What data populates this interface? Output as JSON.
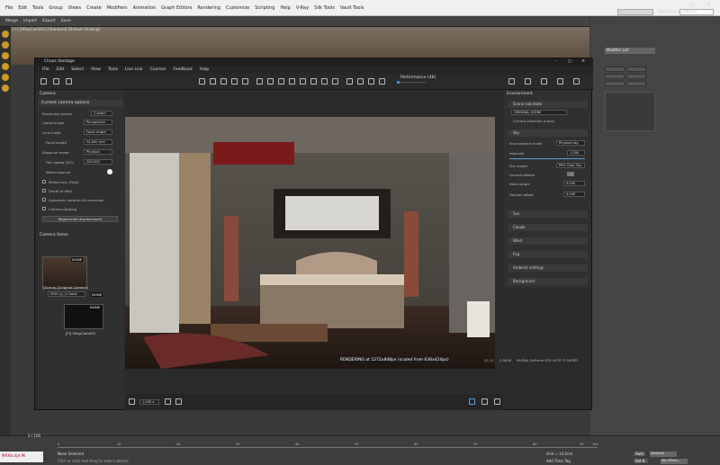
{
  "host": {
    "menu": [
      "File",
      "Edit",
      "Tools",
      "Group",
      "Views",
      "Create",
      "Modifiers",
      "Animation",
      "Graph Editors",
      "Rendering",
      "Customize",
      "Scripting",
      "Help",
      "V-Ray",
      "Silk Tools",
      "Vault Tools"
    ],
    "sign_in": "Sign In",
    "workspaces_label": "Workspaces:",
    "workspace": "Default",
    "toolbar": [
      "Merge",
      "Import",
      "Export",
      "Save"
    ],
    "viewport_label": "[+] [VRayCam001] [Standard] [Default Shading]",
    "modifier_list": "Modifier List",
    "frame": "0 / 100",
    "ruler": [
      "0",
      "10",
      "20",
      "30",
      "40",
      "50",
      "60",
      "70",
      "80",
      "90",
      "100"
    ],
    "status": "None Selected",
    "prompt": "Click or click-and-drag to select objects",
    "maxscript": "MAXScript Mi",
    "grid": "Grid = 10,0cm",
    "add_time_tag": "Add Time Tag",
    "auto": "Auto",
    "set_k": "Set K.",
    "selected": "Selected",
    "key_filters": "Key Filters..."
  },
  "chaos": {
    "title": "Chaos Vantage",
    "menu": [
      "File",
      "Edit",
      "Select",
      "View",
      "Tools",
      "Live Link",
      "Cosmos",
      "Feedback",
      "Help"
    ],
    "performance": "Performance (4K)",
    "camera": {
      "header": "Camera",
      "section": "Current camera options",
      "resolution_preset_label": "Resolution preset",
      "resolution_preset": "Custom",
      "camera_type_label": "Camera type",
      "camera_type": "Perspective",
      "lens_mode_label": "Lens mode",
      "lens_mode": "Focal length",
      "focal_length_label": "Focal length",
      "focal_length": "24,000 mm",
      "exposure_mode_label": "Exposure mode",
      "exposure_mode": "Physical",
      "film_speed_label": "Film speed (ISO)",
      "film_speed": "200,000",
      "white_balance_label": "White balance",
      "motion_blur": "Motion blur (Post)",
      "depth_of_field": "Depth of field",
      "auto_tilt": "Automatic vertical tilt correction",
      "camera_clipping": "Camera clipping",
      "regen_button": "Regenerate displacement"
    },
    "camera_items": {
      "header": "Camera items",
      "items": [
        {
          "name": "[Scene] [Original Camera]",
          "badge": "NONE"
        },
        {
          "name": "[FI] VRayCam001",
          "badge": "NONE"
        }
      ],
      "cam_field": "0001 gr_4 Came",
      "cam_badge": "NONE"
    },
    "viewport": {
      "zoom": "1,000 x"
    },
    "render_status": "RENDERING at 1272x848px (scaled from 636x424px)",
    "render_stats": [
      "32,12",
      "2,900K",
      "NVIDIA GeForce RTX 4070 Ti SUPER"
    ],
    "environment": {
      "header": "Environment",
      "scene_sub_state": "Scene sub-state",
      "scene_value": "ORIGINAL SCENE",
      "scene_hint": "Current selection (none)",
      "sky_header": "Sky",
      "environment_mode_label": "Environment mode",
      "environment_mode": "Physical sky",
      "intensity_label": "Intensity",
      "intensity": "1,000",
      "sky_model_label": "Sky model",
      "sky_model": "PRG Clear Sky",
      "ground_albedo_label": "Ground albedo",
      "blend_angle_label": "Blend angle",
      "blend_angle": "0,000",
      "horizon_offset_label": "Horizon offset",
      "horizon_offset": "0,000",
      "sections": [
        "Sun",
        "Clouds",
        "Wind",
        "Fog",
        "Ambient settings",
        "Background"
      ]
    }
  },
  "colors": {
    "accent": "#c99b2a",
    "panel": "#303030",
    "highlight": "#5aa0e0"
  }
}
